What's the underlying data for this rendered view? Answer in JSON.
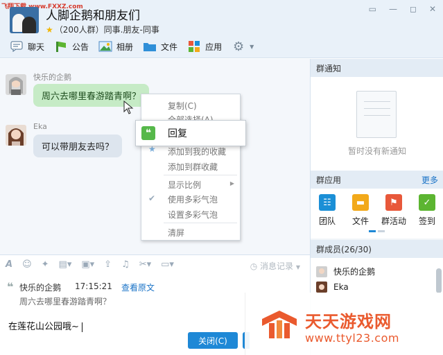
{
  "watermark_top": "飞翔下载 www.FXXZ.com",
  "group": {
    "title": "人脚企鹅和朋友们",
    "subtitle": "（200人群）同事.朋友-同事"
  },
  "window_controls": [
    "◻",
    "—",
    "◻",
    "✕"
  ],
  "toolbar": {
    "chat": "聊天",
    "notice": "公告",
    "album": "相册",
    "file": "文件",
    "apps": "应用"
  },
  "messages": [
    {
      "name": "快乐的企鹅",
      "text": "周六去哪里春游踏青啊？"
    },
    {
      "name": "Eka",
      "text": "可以带朋友去吗？"
    }
  ],
  "context_menu": {
    "copy": "复制(C)",
    "select_all": "全部选择(A)",
    "reply": "回复",
    "add_my_fav": "添加到我的收藏",
    "add_group_fav": "添加到群收藏",
    "display_ratio": "显示比例",
    "use_bubble": "使用多彩气泡",
    "set_bubble": "设置多彩气泡",
    "clear": "清屏"
  },
  "input": {
    "history_label": "消息记录",
    "quote_name": "快乐的企鹅",
    "quote_time": "17:15:21",
    "quote_link": "查看原文",
    "quote_text": "周六去哪里春游踏青啊？",
    "typed_text": "在莲花山公园哦~",
    "close_button": "关闭(C)"
  },
  "right_panel": {
    "notice_header": "群通知",
    "notice_empty": "暂时没有新通知",
    "apps_header": "群应用",
    "apps_more": "更多",
    "apps": [
      {
        "label": "团队",
        "color": "#1b8fd6",
        "glyph": "☷"
      },
      {
        "label": "文件",
        "color": "#f2a91a",
        "glyph": "▬"
      },
      {
        "label": "群活动",
        "color": "#e8583a",
        "glyph": "⚑"
      },
      {
        "label": "签到",
        "color": "#5cb531",
        "glyph": "✓"
      }
    ],
    "members_header": "群成员(26/30)",
    "members": [
      {
        "name": "快乐的企鹅"
      },
      {
        "name": "Eka"
      }
    ]
  },
  "brand": {
    "name": "天天游戏网",
    "url": "www.ttyl23.com"
  }
}
